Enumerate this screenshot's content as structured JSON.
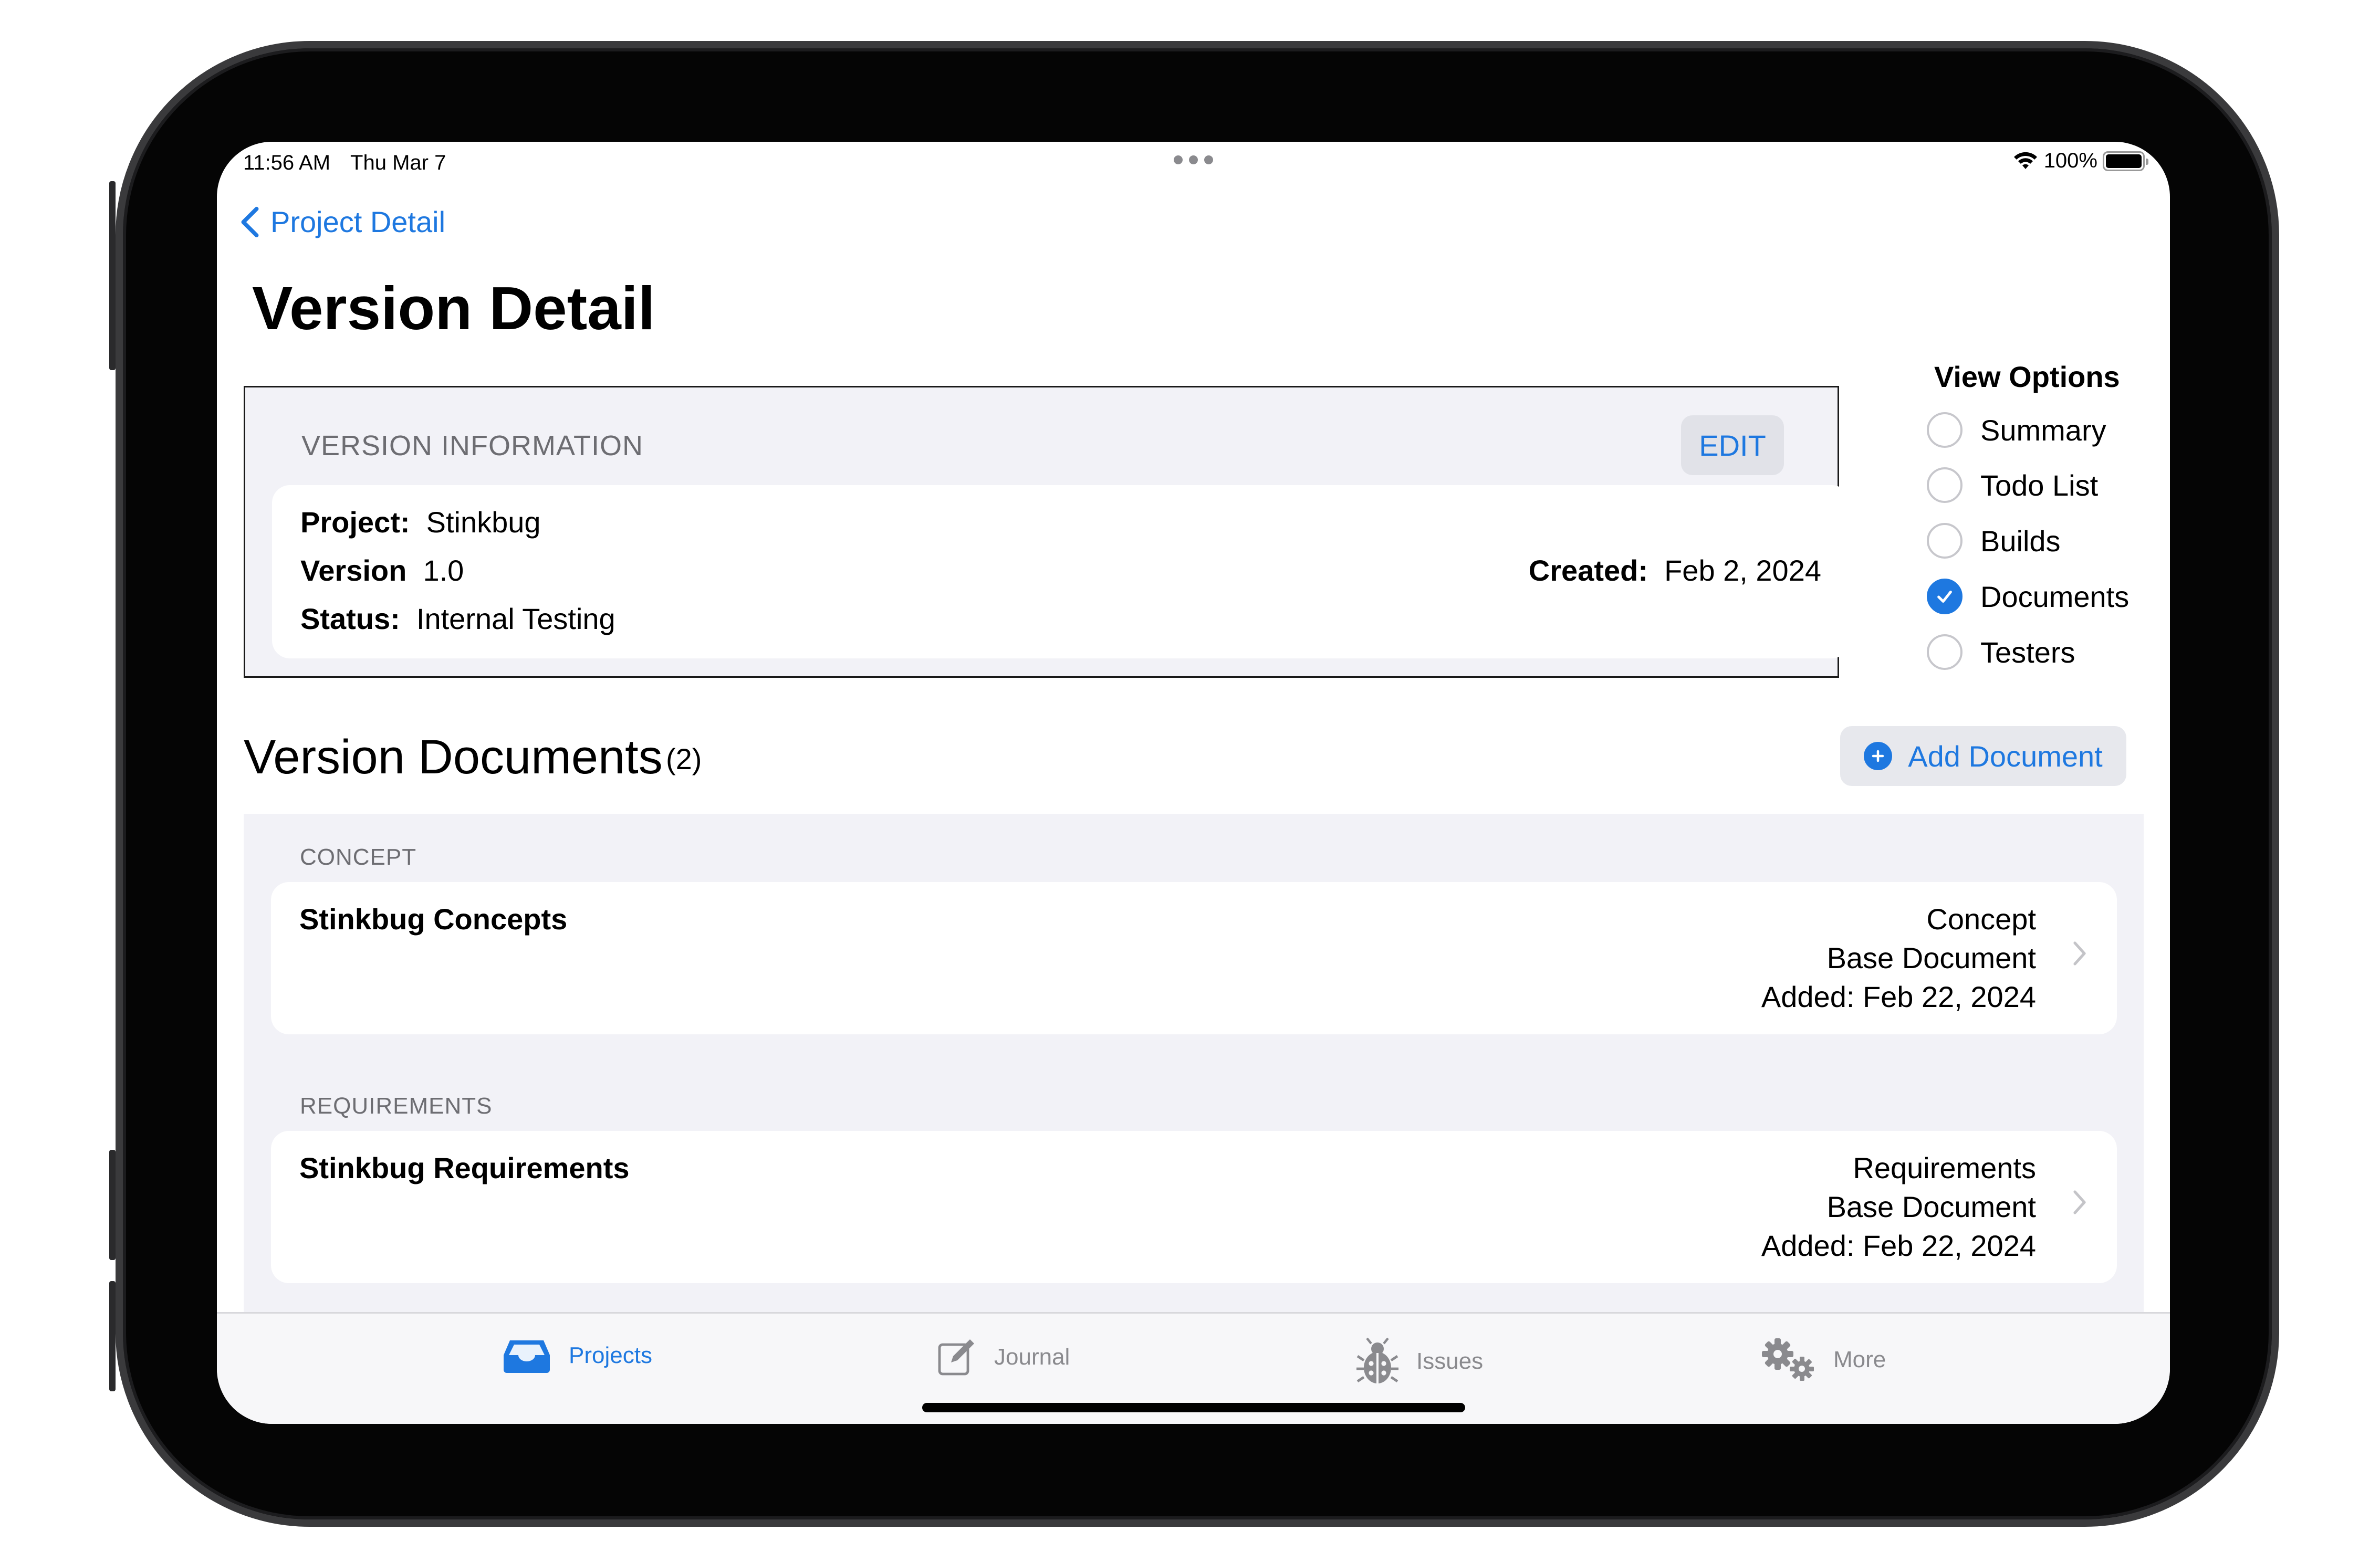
{
  "status_bar": {
    "time": "11:56 AM",
    "date": "Thu Mar 7",
    "battery": "100%",
    "battery_level": 1.0
  },
  "nav": {
    "back_label": "Project Detail",
    "title": "Version Detail"
  },
  "version_info": {
    "header": "VERSION INFORMATION",
    "edit_label": "EDIT",
    "project_label": "Project:",
    "project_value": "Stinkbug",
    "version_label": "Version",
    "version_value": "1.0",
    "status_label": "Status:",
    "status_value": "Internal Testing",
    "created_label": "Created:",
    "created_value": "Feb 2, 2024"
  },
  "view_options": {
    "title": "View Options",
    "items": [
      {
        "label": "Summary",
        "checked": false
      },
      {
        "label": "Todo List",
        "checked": false
      },
      {
        "label": "Builds",
        "checked": false
      },
      {
        "label": "Documents",
        "checked": true
      },
      {
        "label": "Testers",
        "checked": false
      }
    ]
  },
  "documents": {
    "title": "Version Documents",
    "count": "(2)",
    "add_label": "Add Document",
    "groups": [
      {
        "label": "CONCEPT",
        "name": "Stinkbug Concepts",
        "type": "Concept",
        "kind": "Base Document",
        "added": "Added: Feb 22, 2024"
      },
      {
        "label": "REQUIREMENTS",
        "name": "Stinkbug Requirements",
        "type": "Requirements",
        "kind": "Base Document",
        "added": "Added: Feb 22, 2024"
      }
    ]
  },
  "tabs": [
    {
      "label": "Projects",
      "icon": "tray-icon",
      "active": true
    },
    {
      "label": "Journal",
      "icon": "compose-icon",
      "active": false
    },
    {
      "label": "Issues",
      "icon": "ladybug-icon",
      "active": false
    },
    {
      "label": "More",
      "icon": "gears-icon",
      "active": false
    }
  ],
  "colors": {
    "accent": "#1e78e0",
    "grouped_background": "#f2f2f7",
    "secondary_text": "#6d6d72"
  }
}
